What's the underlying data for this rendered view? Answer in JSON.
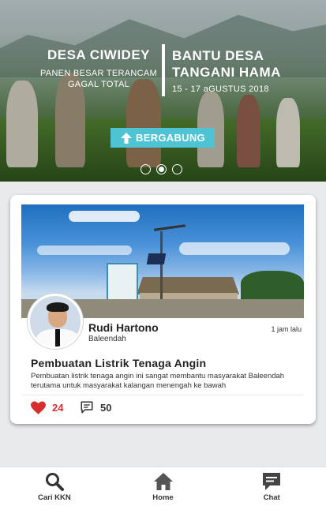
{
  "hero": {
    "left_title": "DESA CIWIDEY",
    "left_subtitle": "PANEN BESAR TERANCAM GAGAL TOTAL",
    "right_title": "BANTU DESA TANGANI HAMA",
    "right_date": "15 - 17 aGUSTUS 2018",
    "join_label": "BERGABUNG",
    "carousel": {
      "count": 3,
      "active_index": 1
    }
  },
  "post": {
    "user_name": "Rudi Hartono",
    "user_location": "Baleendah",
    "time_ago": "1 jam lalu",
    "title": "Pembuatan Listrik Tenaga Angin",
    "description": "Pembuatan listrik tenaga angin ini sangat membantu masyarakat Baleendah terutama untuk masyarakat kalangan menengah ke bawah",
    "likes": "24",
    "comments": "50"
  },
  "bottom_nav": {
    "items": [
      {
        "label": "Cari KKN",
        "icon": "search-icon"
      },
      {
        "label": "Home",
        "icon": "home-icon"
      },
      {
        "label": "Chat",
        "icon": "chat-icon"
      }
    ]
  },
  "colors": {
    "accent": "#4ec3d3",
    "like": "#d62e2e",
    "icon": "#333333"
  }
}
